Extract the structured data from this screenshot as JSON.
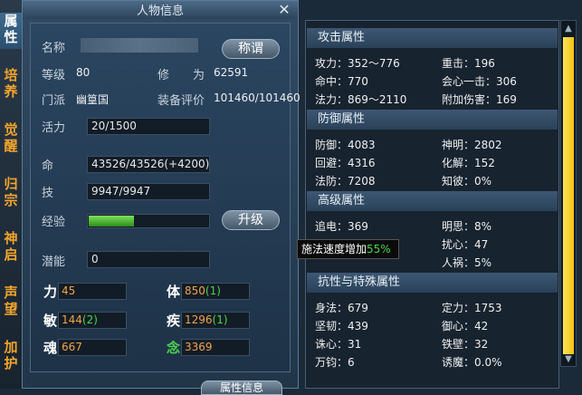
{
  "side_tabs": [
    "属性",
    "培养",
    "觉醒",
    "归宗",
    "神启",
    "声望",
    "加护"
  ],
  "window": {
    "title": "人物信息"
  },
  "profile": {
    "name_label": "名称",
    "rename_button": "称谓",
    "level_label": "等级",
    "level_value": "80",
    "cultivation_label": "修　　为",
    "cultivation_value": "62591",
    "faction_label": "门派",
    "faction_value": "幽篁国",
    "equip_label": "装备评价",
    "equip_value": "101460/101460",
    "vitality_label": "活力",
    "vitality_value": "20/1500",
    "life_label": "命",
    "life_value": "43526/43526(+4200)",
    "skill_label": "技",
    "skill_value": "9947/9947",
    "exp_label": "经验",
    "exp_fraction": 0.38,
    "upgrade_button": "升级",
    "potential_label": "潜能",
    "potential_value": "0"
  },
  "stats": [
    {
      "label": "力",
      "base": "45",
      "bonus": ""
    },
    {
      "label": "体",
      "base": "850",
      "bonus": "(1)"
    },
    {
      "label": "敏",
      "base": "144",
      "bonus": "(2)"
    },
    {
      "label": "疾",
      "base": "1296",
      "bonus": "(1)"
    },
    {
      "label": "魂",
      "base": "667",
      "bonus": ""
    },
    {
      "label": "念",
      "base": "3369",
      "bonus": ""
    }
  ],
  "bottom_button": "属性信息",
  "sections": {
    "attack": {
      "title": "攻击属性",
      "rows": [
        "攻力：352～776",
        "重击：196",
        "命中：770",
        "会心一击：306",
        "法力：869～2110",
        "附加伤害：169"
      ]
    },
    "defense": {
      "title": "防御属性",
      "rows": [
        "防御：4083",
        "神明：2802",
        "回避：4316",
        "化解：152",
        "法防：7208",
        "知彼：0%"
      ]
    },
    "advanced": {
      "title": "高级属性",
      "rows": [
        "追电：369",
        "明思：8%",
        "扰心：47",
        "人祸：5%"
      ]
    },
    "resist": {
      "title": "抗性与特殊属性",
      "rows": [
        "身法：679",
        "定力：1753",
        "坚韧：439",
        "御心：42",
        "诛心：31",
        "铁壁：32",
        "万钧：6",
        "诱魔：0.0%"
      ]
    }
  },
  "tooltip": {
    "text": "施法速度增加",
    "value": "55%"
  },
  "colors": {
    "accent": "#f0a34a",
    "green": "#4ed24e",
    "scrollbar": "#f2c312"
  }
}
